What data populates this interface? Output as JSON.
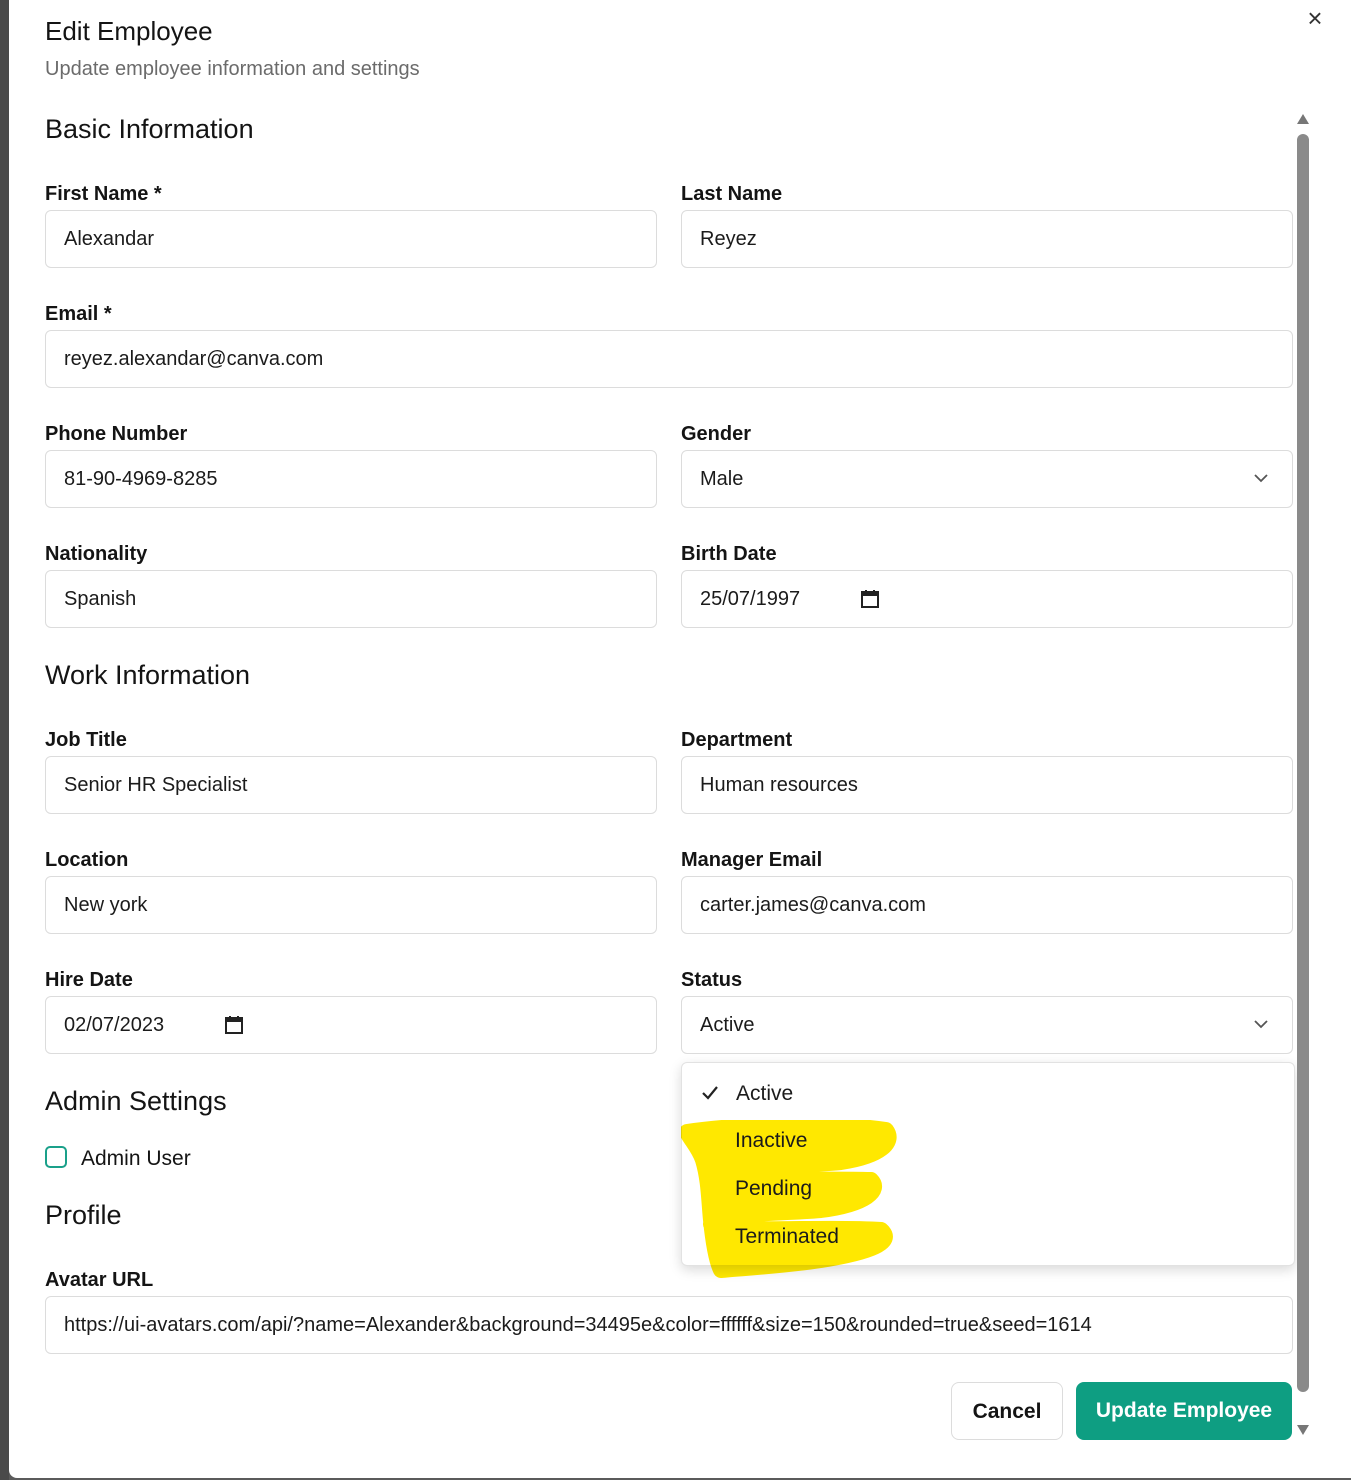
{
  "dialog": {
    "title": "Edit Employee",
    "subtitle": "Update employee information and settings",
    "close_icon": "×"
  },
  "sections": {
    "basic": "Basic Information",
    "work": "Work Information",
    "admin": "Admin Settings",
    "profile": "Profile"
  },
  "fields": {
    "first_name": {
      "label": "First Name *",
      "value": "Alexandar"
    },
    "last_name": {
      "label": "Last Name",
      "value": "Reyez"
    },
    "email": {
      "label": "Email *",
      "value": "reyez.alexandar@canva.com"
    },
    "phone": {
      "label": "Phone Number",
      "value": "81-90-4969-8285"
    },
    "gender": {
      "label": "Gender",
      "value": "Male"
    },
    "nationality": {
      "label": "Nationality",
      "value": "Spanish"
    },
    "birth_date": {
      "label": "Birth Date",
      "value": "25/07/1997"
    },
    "job_title": {
      "label": "Job Title",
      "value": "Senior HR Specialist"
    },
    "department": {
      "label": "Department",
      "value": "Human resources"
    },
    "location": {
      "label": "Location",
      "value": "New york"
    },
    "manager_email": {
      "label": "Manager Email",
      "value": "carter.james@canva.com"
    },
    "hire_date": {
      "label": "Hire Date",
      "value": "02/07/2023"
    },
    "status": {
      "label": "Status",
      "value": "Active"
    },
    "admin_user": {
      "label": "Admin User",
      "checked": false
    },
    "avatar_url": {
      "label": "Avatar URL",
      "value": "https://ui-avatars.com/api/?name=Alexander&background=34495e&color=ffffff&size=150&rounded=true&seed=1614"
    }
  },
  "status_options": [
    "Active",
    "Inactive",
    "Pending",
    "Terminated"
  ],
  "status_selected": "Active",
  "buttons": {
    "cancel": "Cancel",
    "update": "Update Employee"
  },
  "colors": {
    "primary": "#0e9e82",
    "highlight": "#ffe800",
    "checkbox_border": "#1aa08a"
  },
  "icons": {
    "close": "close-icon",
    "chevron": "chevron-down-icon",
    "calendar": "calendar-icon",
    "check": "check-icon"
  }
}
